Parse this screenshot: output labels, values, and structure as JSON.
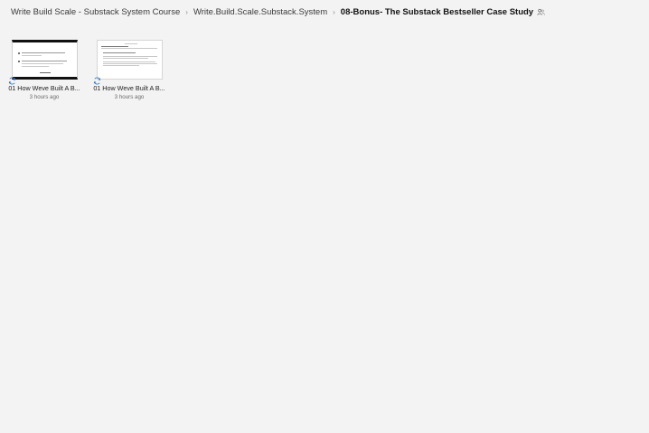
{
  "breadcrumb": {
    "items": [
      "Write Build Scale - Substack System Course",
      "Write.Build.Scale.Substack.System",
      "08-Bonus- The Substack Bestseller Case Study"
    ],
    "separator": "›",
    "current_icon": "shared-people-icon"
  },
  "files": [
    {
      "name": "01 How Weve Built A B...",
      "modified": "3 hours ago",
      "thumbnail": "slide-dark-border",
      "status_icon": "sync-pending-icon"
    },
    {
      "name": "01 How Weve Built A B...",
      "modified": "3 hours ago",
      "thumbnail": "document-page",
      "status_icon": "sync-pending-icon"
    }
  ],
  "colors": {
    "background": "#f3f3f3",
    "text": "#1f1f1f",
    "muted": "#6a6a6a",
    "sync": "#3b7bbf"
  }
}
